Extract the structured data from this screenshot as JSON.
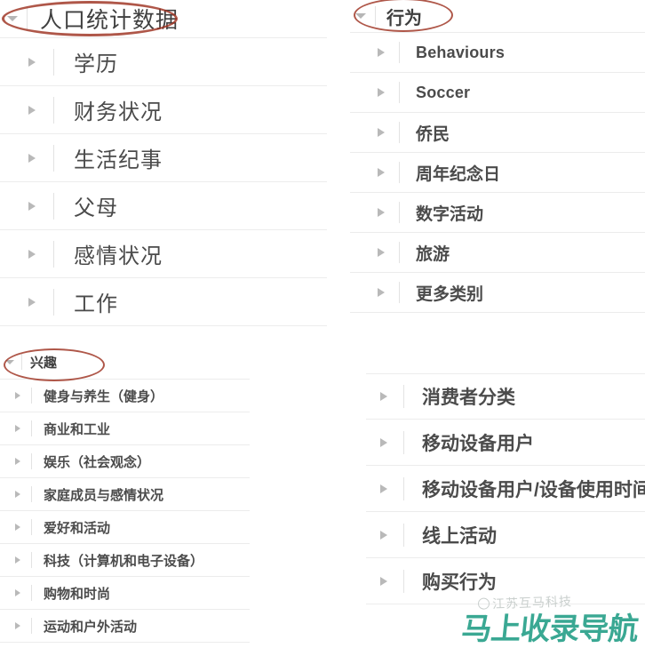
{
  "panels": {
    "demographics": {
      "header": {
        "label": "人口统计数据",
        "caret": "caret-down-icon"
      },
      "items": [
        {
          "label": "学历"
        },
        {
          "label": "财务状况"
        },
        {
          "label": "生活纪事"
        },
        {
          "label": "父母"
        },
        {
          "label": "感情状况"
        },
        {
          "label": "工作"
        }
      ]
    },
    "interests": {
      "header": {
        "label": "兴趣",
        "caret": "caret-down-icon"
      },
      "items": [
        {
          "label": "健身与养生（健身）"
        },
        {
          "label": "商业和工业"
        },
        {
          "label": "娱乐（社会观念）"
        },
        {
          "label": "家庭成员与感情状况"
        },
        {
          "label": "爱好和活动"
        },
        {
          "label": "科技（计算机和电子设备）"
        },
        {
          "label": "购物和时尚"
        },
        {
          "label": "运动和户外活动"
        }
      ]
    },
    "behavior": {
      "header": {
        "label": "行为",
        "caret": "caret-down-icon"
      },
      "items": [
        {
          "label": "Behaviours"
        },
        {
          "label": "Soccer"
        },
        {
          "label": "侨民"
        },
        {
          "label": "周年纪念日"
        },
        {
          "label": "数字活动"
        },
        {
          "label": "旅游"
        },
        {
          "label": "更多类别"
        }
      ]
    },
    "consumer": {
      "items": [
        {
          "label": "消费者分类"
        },
        {
          "label": "移动设备用户"
        },
        {
          "label": "移动设备用户/设备使用时间"
        },
        {
          "label": "线上活动"
        },
        {
          "label": "购买行为"
        }
      ]
    }
  },
  "annotations": {
    "ellipse_color": "#9e3221",
    "highlights": [
      {
        "target": "人口统计数据"
      },
      {
        "target": "兴趣"
      },
      {
        "target": "行为"
      }
    ]
  },
  "watermark": {
    "small_text": "江苏互马科技",
    "big_text": "马上收录导航",
    "big_color": "#3aa893"
  }
}
